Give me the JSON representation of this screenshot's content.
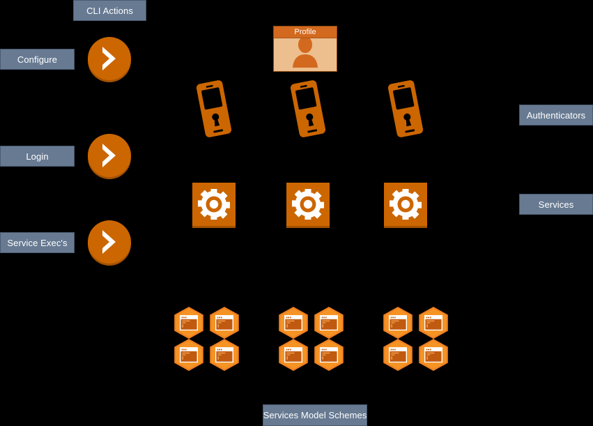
{
  "diagram": {
    "title": "Services Model Schemes",
    "background_color": "#000000",
    "accent_orange": "#CC6600",
    "label_color": "#677A92",
    "profile_body_color": "#EDBE8E"
  },
  "top_labels": [
    {
      "id": "cli-actions",
      "text": "CLI Actions"
    }
  ],
  "left_labels": [
    {
      "id": "configure",
      "text": "Configure"
    },
    {
      "id": "login",
      "text": "Login"
    },
    {
      "id": "service-execs",
      "text": "Service Exec's"
    }
  ],
  "right_labels": [
    {
      "id": "authenticators",
      "text": "Authenticators"
    },
    {
      "id": "services",
      "text": "Services"
    }
  ],
  "bottom_labels": [
    {
      "id": "services-model-schemes",
      "text": "Services Model Schemes"
    }
  ],
  "profile": {
    "title": "Profile",
    "icon": "user-silhouette-icon"
  },
  "chevron_buttons": [
    {
      "id": "chevron-configure",
      "icon": "chevron-right-icon"
    },
    {
      "id": "chevron-login",
      "icon": "chevron-right-icon"
    },
    {
      "id": "chevron-service-execs",
      "icon": "chevron-right-icon"
    }
  ],
  "authenticator_rows": [
    {
      "id": "authenticator-1",
      "icon": "phone-lock-icon"
    },
    {
      "id": "authenticator-2",
      "icon": "phone-lock-icon"
    },
    {
      "id": "authenticator-3",
      "icon": "phone-lock-icon"
    }
  ],
  "service_rows": [
    {
      "id": "service-1",
      "icon": "gear-icon"
    },
    {
      "id": "service-2",
      "icon": "gear-icon"
    },
    {
      "id": "service-3",
      "icon": "gear-icon"
    }
  ],
  "scheme_clusters": [
    {
      "id": "scheme-cluster-1",
      "icon": "hexagon-window-cluster-icon",
      "count": 4
    },
    {
      "id": "scheme-cluster-2",
      "icon": "hexagon-window-cluster-icon",
      "count": 4
    },
    {
      "id": "scheme-cluster-3",
      "icon": "hexagon-window-cluster-icon",
      "count": 4
    }
  ]
}
